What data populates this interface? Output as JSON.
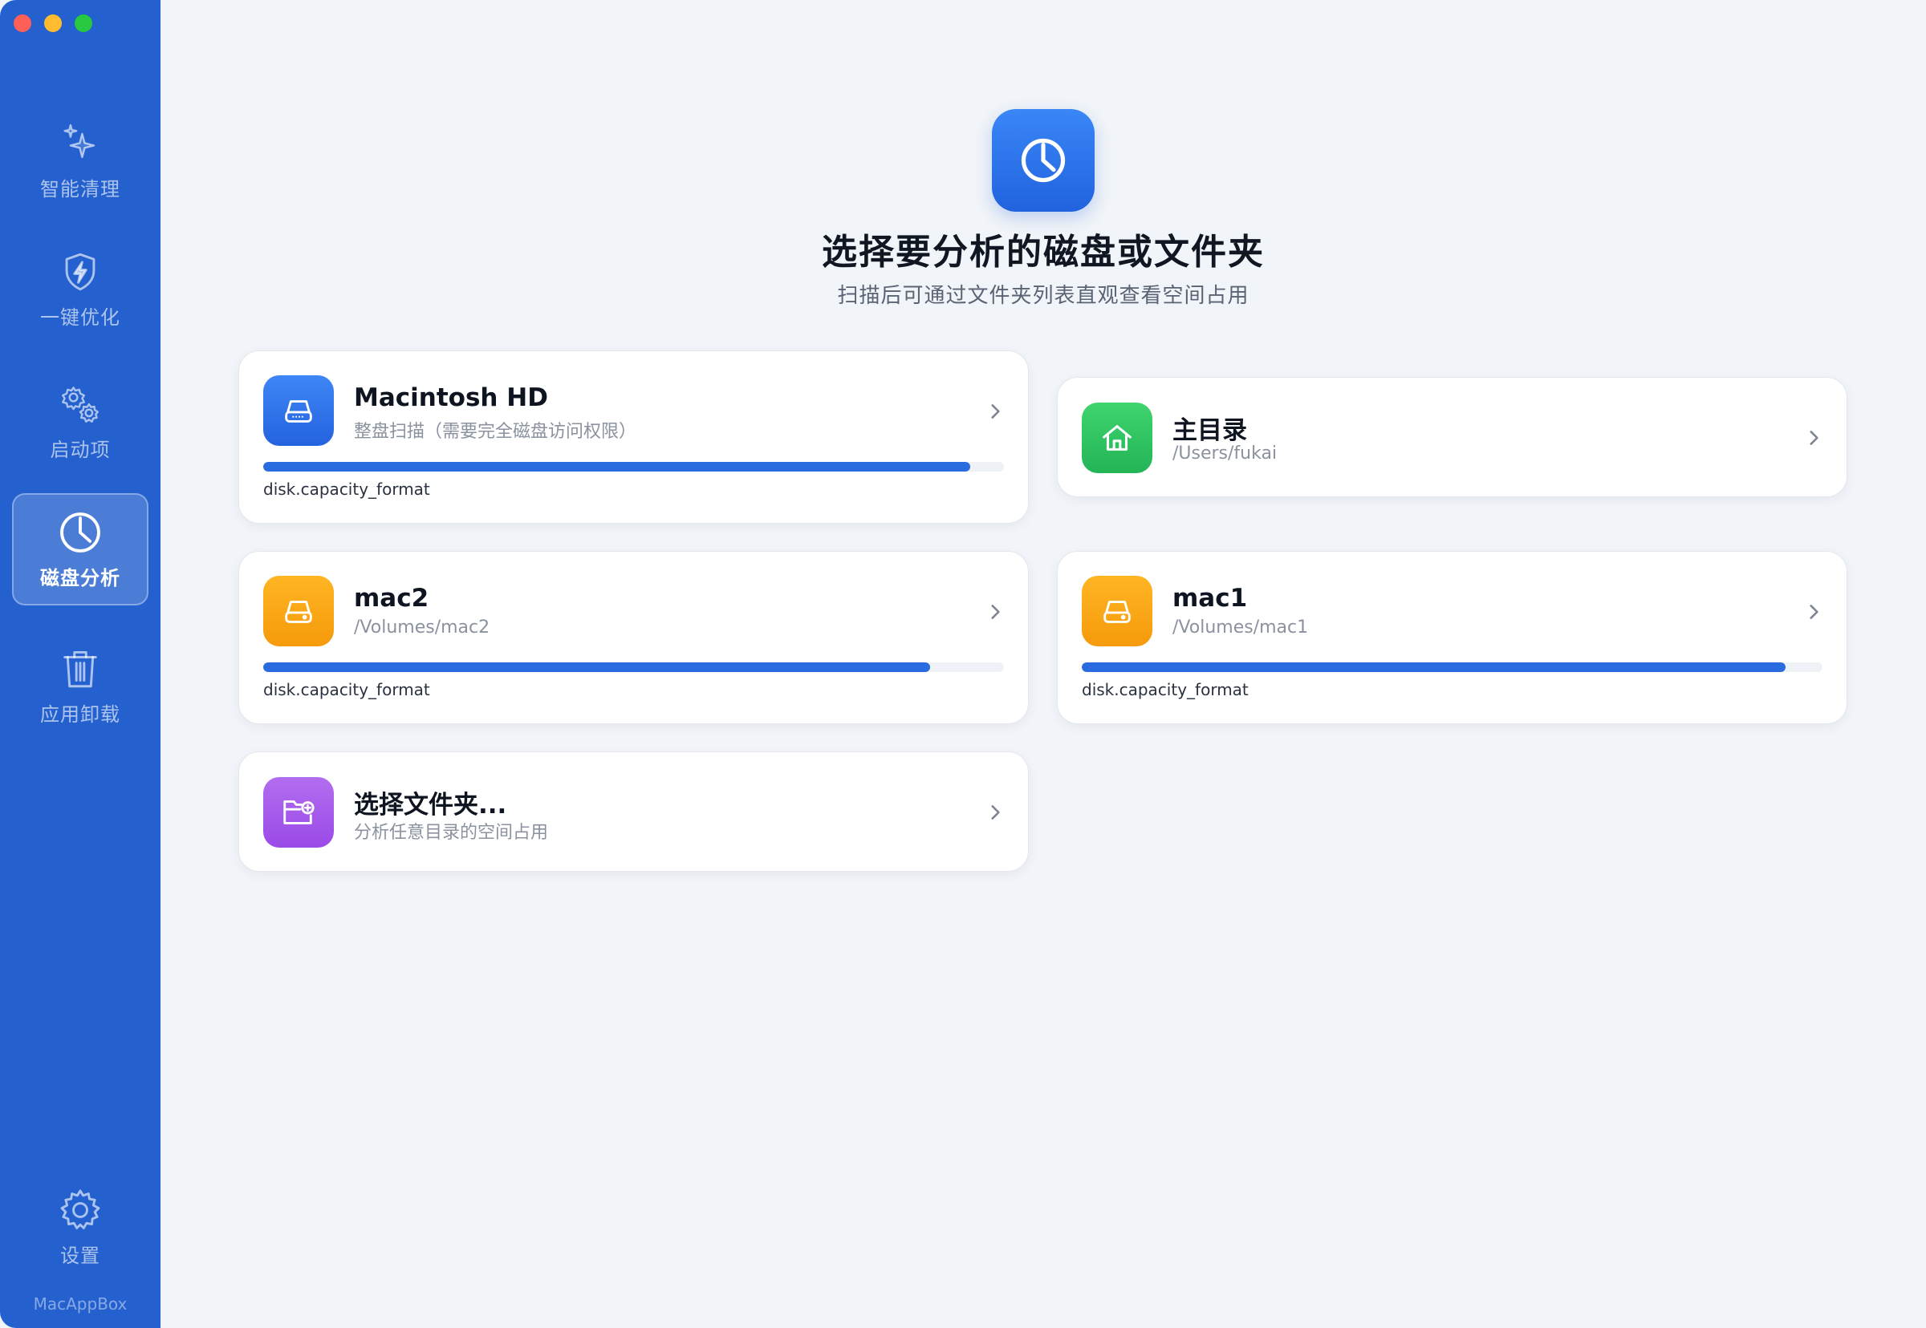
{
  "window": {
    "traffic_lights": [
      "close",
      "minimize",
      "maximize"
    ]
  },
  "sidebar": {
    "items": [
      {
        "label": "智能清理",
        "icon": "sparkle-icon",
        "active": false
      },
      {
        "label": "一键优化",
        "icon": "shield-bolt-icon",
        "active": false
      },
      {
        "label": "启动项",
        "icon": "gears-icon",
        "active": false
      },
      {
        "label": "磁盘分析",
        "icon": "pie-chart-icon",
        "active": true
      },
      {
        "label": "应用卸载",
        "icon": "trash-icon",
        "active": false
      }
    ],
    "settings_label": "设置",
    "brand": "MacAppBox"
  },
  "header": {
    "title": "选择要分析的磁盘或文件夹",
    "subtitle": "扫描后可通过文件夹列表直观查看空间占用"
  },
  "cards": {
    "macintosh": {
      "title": "Macintosh HD",
      "path": "整盘扫描（需要完全磁盘访问权限）",
      "capacity": "disk.capacity_format",
      "usage": 0.955,
      "icon": "drive-icon"
    },
    "home": {
      "title": "主目录",
      "path": "/Users/fukai",
      "icon": "home-icon"
    },
    "mac2": {
      "title": "mac2",
      "path": "/Volumes/mac2",
      "capacity": "disk.capacity_format",
      "usage": 0.9,
      "icon": "drive-icon"
    },
    "mac1": {
      "title": "mac1",
      "path": "/Volumes/mac1",
      "capacity": "disk.capacity_format",
      "usage": 0.95,
      "icon": "drive-icon"
    },
    "folder": {
      "title": "选择文件夹...",
      "path": "分析任意目录的空间占用",
      "icon": "folder-add-icon"
    }
  },
  "colors": {
    "sidebar": "#2461cf",
    "accent": "#2b6be0",
    "background": "#f1f4f8"
  }
}
